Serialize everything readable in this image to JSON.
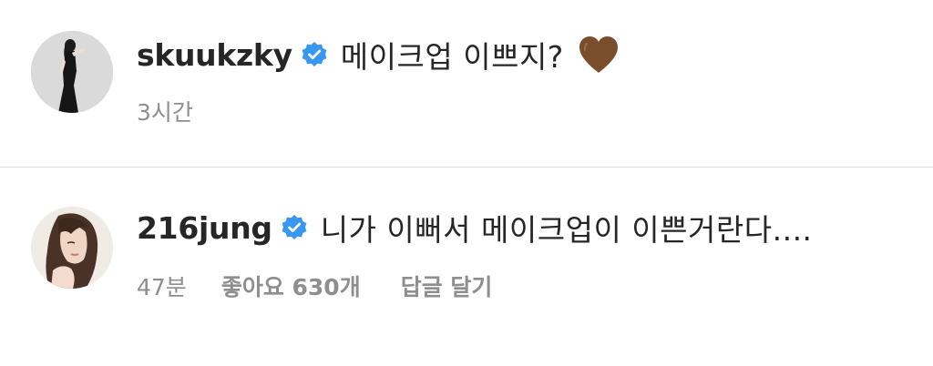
{
  "comments": [
    {
      "username": "skuukzky",
      "text": "메이크업 이쁘지?",
      "emoji": "brown-heart-icon",
      "time": "3시간",
      "verified": true
    },
    {
      "username": "216jung",
      "text": "니가 이뻐서 메이크업이 이쁜거란다....",
      "time": "47분",
      "likes": "좋아요 630개",
      "reply_label": "답글 달기",
      "verified": true
    }
  ],
  "colors": {
    "verified_badge": "#3897f0",
    "heart": "#7a4e2d",
    "meta_text": "#8e8e8e",
    "divider": "#dbdbdb"
  }
}
